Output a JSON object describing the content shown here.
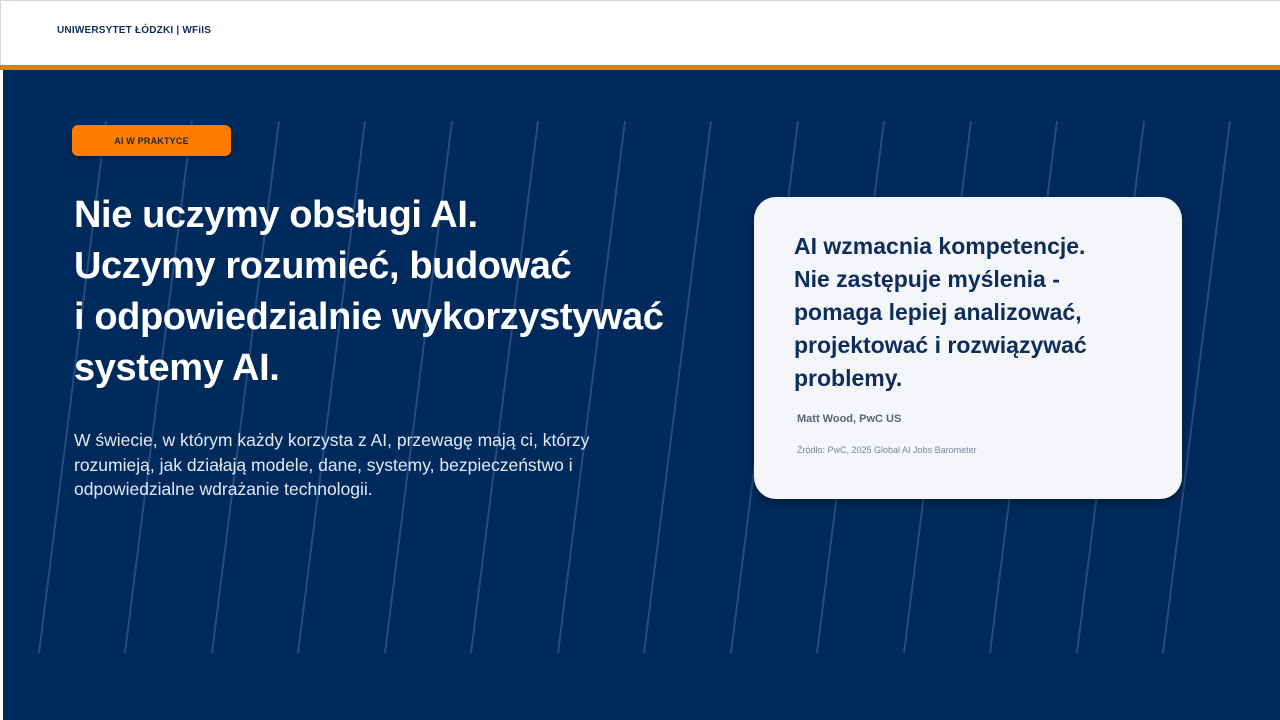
{
  "header": {
    "label": "UNIWERSYTET ŁÓDZKI  |  WFiIS"
  },
  "colors": {
    "background": "#002a5c",
    "accent": "#f07d00",
    "pill": "#ff7c00",
    "card": "#f4f6fa"
  },
  "tag": {
    "label": "AI W PRAKTYCE"
  },
  "headline": {
    "lines": [
      "Nie uczymy obsługi AI.",
      "Uczymy rozumieć, budować",
      "i odpowiedzialnie wykorzystywać",
      "systemy AI."
    ]
  },
  "body": {
    "text": "W świecie, w którym każdy korzysta z AI, przewagę mają ci, którzy rozumieją, jak działają modele, dane, systemy, bezpieczeństwo i odpowiedzialne wdrażanie technologii."
  },
  "quote": {
    "lines": [
      "AI wzmacnia kompetencje.",
      "Nie zastępuje myślenia -",
      "pomaga lepiej analizować,",
      "projektować i rozwiązywać",
      "problemy."
    ],
    "author": "Matt Wood, PwC US",
    "source": "Źródło: PwC, 2025 Global AI Jobs Barometer"
  }
}
